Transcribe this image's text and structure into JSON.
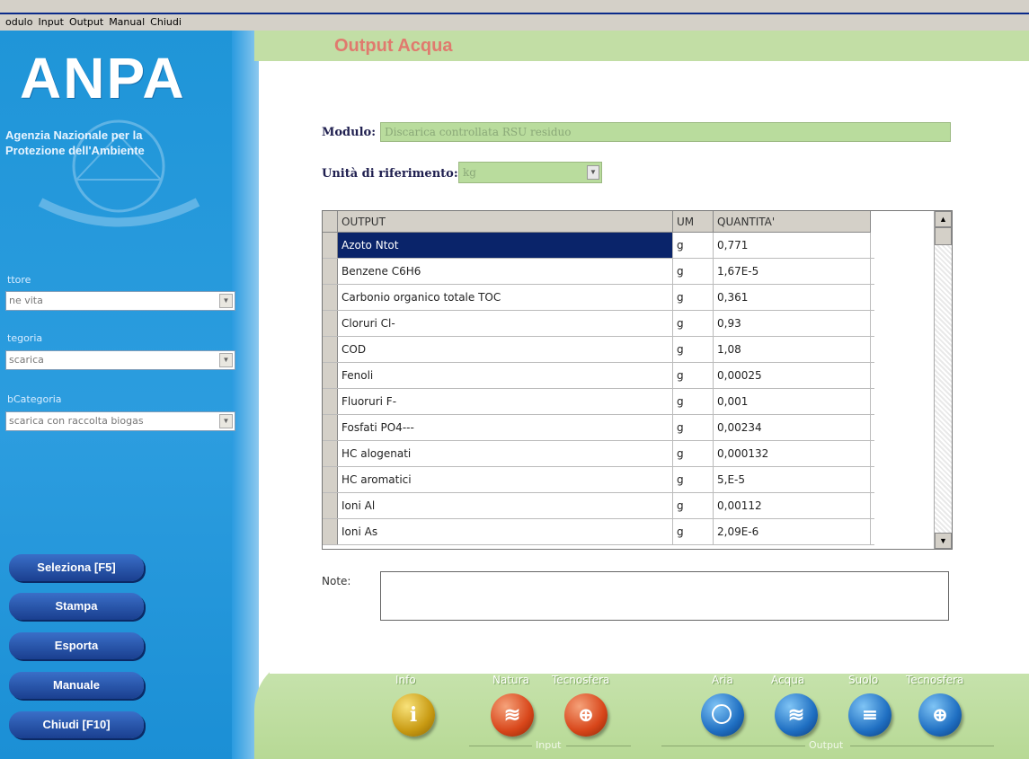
{
  "menu": [
    "odulo",
    "Input",
    "Output",
    "Manual",
    "Chiudi"
  ],
  "sidebar": {
    "logo": "ANPA",
    "agency_line1": "Agenzia Nazionale per la",
    "agency_line2": "Protezione dell'Ambiente",
    "filters": [
      {
        "label": "ttore",
        "value": "ne vita"
      },
      {
        "label": "tegoria",
        "value": "scarica"
      },
      {
        "label": "bCategoria",
        "value": "scarica con raccolta biogas"
      }
    ],
    "buttons": [
      "Seleziona [F5]",
      "Stampa",
      "Esporta",
      "Manuale",
      "Chiudi [F10]"
    ]
  },
  "main": {
    "title": "Output Acqua",
    "modulo_label": "Modulo:",
    "modulo_value": "Discarica controllata RSU residuo",
    "unit_label": "Unità di riferimento:",
    "unit_value": "kg",
    "note_label": "Note:"
  },
  "table": {
    "headers": [
      "OUTPUT",
      "UM",
      "QUANTITA'"
    ],
    "rows": [
      {
        "name": "Azoto Ntot",
        "um": "g",
        "qty": "0,771"
      },
      {
        "name": "Benzene C6H6",
        "um": "g",
        "qty": "1,67E-5"
      },
      {
        "name": "Carbonio organico totale TOC",
        "um": "g",
        "qty": "0,361"
      },
      {
        "name": "Cloruri Cl-",
        "um": "g",
        "qty": "0,93"
      },
      {
        "name": "COD",
        "um": "g",
        "qty": "1,08"
      },
      {
        "name": "Fenoli",
        "um": "g",
        "qty": "0,00025"
      },
      {
        "name": "Fluoruri F-",
        "um": "g",
        "qty": "0,001"
      },
      {
        "name": "Fosfati PO4---",
        "um": "g",
        "qty": "0,00234"
      },
      {
        "name": "HC alogenati",
        "um": "g",
        "qty": "0,000132"
      },
      {
        "name": "HC aromatici",
        "um": "g",
        "qty": "5,E-5"
      },
      {
        "name": "Ioni Al",
        "um": "g",
        "qty": "0,00112"
      },
      {
        "name": "Ioni As",
        "um": "g",
        "qty": "2,09E-6"
      }
    ]
  },
  "bottom": {
    "info": "Info",
    "natura": "Natura",
    "tecnosfera_in": "Tecnosfera",
    "aria": "Aria",
    "acqua": "Acqua",
    "suolo": "Suolo",
    "tecnosfera_out": "Tecnosfera",
    "group_input": "Input",
    "group_output": "Output"
  },
  "colors": {
    "sidebar": "#1f95d8",
    "title": "#e07a6e",
    "field_green": "#b9dc9d",
    "selection": "#0a246a"
  }
}
